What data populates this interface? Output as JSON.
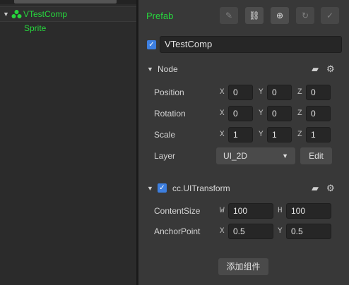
{
  "hierarchy": {
    "root": {
      "label": "VTestComp",
      "expand_icon": "triangle-down-icon",
      "node_icon": "prefab-node-icon"
    },
    "child": {
      "label": "Sprite"
    }
  },
  "inspector": {
    "prefab_label": "Prefab",
    "toolbar": [
      {
        "name": "edit-prefab-button",
        "icon": "edit-icon",
        "glyph": "✎"
      },
      {
        "name": "unlink-prefab-button",
        "icon": "unlink-icon",
        "glyph": "⛓"
      },
      {
        "name": "locate-asset-button",
        "icon": "crosshair-icon",
        "glyph": "⊕"
      },
      {
        "name": "revert-prefab-button",
        "icon": "revert-icon",
        "glyph": "↻"
      },
      {
        "name": "apply-prefab-button",
        "icon": "check-circle-icon",
        "glyph": "✓"
      }
    ],
    "node_name": "VTestComp",
    "node_section": {
      "title": "Node",
      "position": {
        "label": "Position",
        "x": "0",
        "y": "0",
        "z": "0"
      },
      "rotation": {
        "label": "Rotation",
        "x": "0",
        "y": "0",
        "z": "0"
      },
      "scale": {
        "label": "Scale",
        "x": "1",
        "y": "1",
        "z": "1"
      },
      "layer": {
        "label": "Layer",
        "value": "UI_2D",
        "edit_label": "Edit"
      }
    },
    "uitransform_section": {
      "title": "cc.UITransform",
      "content_size": {
        "label": "ContentSize",
        "w": "100",
        "h": "100"
      },
      "anchor_point": {
        "label": "AnchorPoint",
        "x": "0.5",
        "y": "0.5"
      }
    },
    "add_component_label": "添加组件",
    "axis_letters": {
      "x": "X",
      "y": "Y",
      "z": "Z",
      "w": "W",
      "h": "H"
    }
  },
  "colors": {
    "prefab_green": "#27d63d",
    "checkbox_blue": "#3d7fe0",
    "panel_bg": "#383838"
  }
}
